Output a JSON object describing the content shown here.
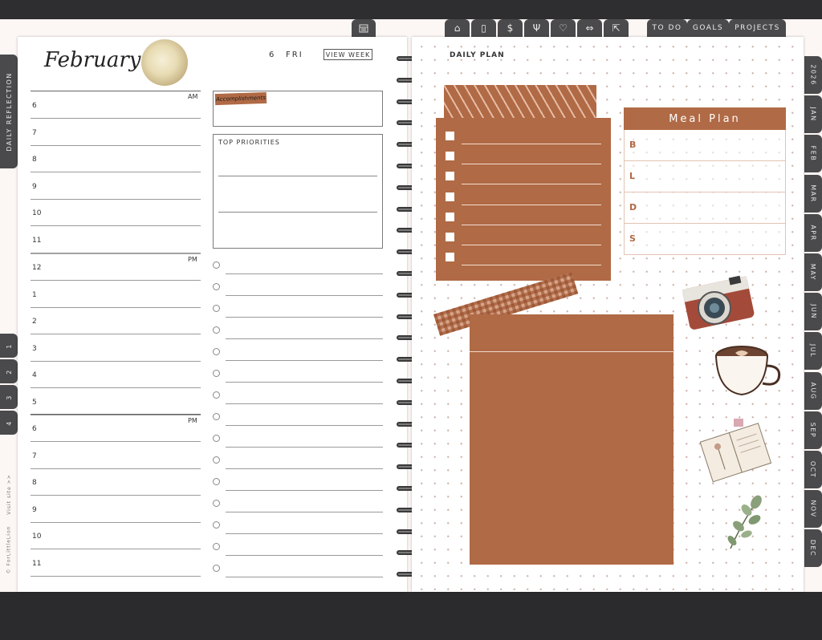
{
  "header": {
    "calendar_icon": "calendar-icon",
    "nav_icons": [
      "home-icon",
      "document-icon",
      "dollar-icon",
      "fork-knife-icon",
      "heart-icon",
      "dumbbell-icon",
      "external-link-icon"
    ],
    "nav_tabs": [
      "TO DO",
      "GOALS",
      "PROJECTS"
    ]
  },
  "left_sidebar": {
    "daily_reflection": "DAILY REFLECTION",
    "week_tabs": [
      "1",
      "2",
      "3",
      "4"
    ],
    "visit_site": "Visit site >>",
    "copyright": "© ForLittleLion"
  },
  "right_sidebar": {
    "months": [
      "2026",
      "JAN",
      "FEB",
      "MAR",
      "APR",
      "MAY",
      "JUN",
      "JUL",
      "AUG",
      "SEP",
      "OCT",
      "NOV",
      "DEC"
    ]
  },
  "left_page": {
    "month": "February",
    "date": "6",
    "weekday": "FRI",
    "view_week": "VIEW WEEK",
    "am_label": "AM",
    "pm_label": "PM",
    "pm_label_2": "PM",
    "hours_am": [
      "6",
      "7",
      "8",
      "9",
      "10",
      "11"
    ],
    "hours_pm1": [
      "12",
      "1",
      "2",
      "3",
      "4",
      "5"
    ],
    "hours_pm2": [
      "6",
      "7",
      "8",
      "9",
      "10",
      "11"
    ],
    "accomplishments": "Accomplishments",
    "top_priorities": "TOP PRIORITIES"
  },
  "right_page": {
    "title": "DAILY PLAN",
    "meal_plan": {
      "title": "Meal Plan",
      "rows": [
        "B",
        "L",
        "D",
        "S"
      ]
    }
  },
  "colors": {
    "rust": "#b06a45",
    "tab_dark": "#4a4a4c"
  }
}
